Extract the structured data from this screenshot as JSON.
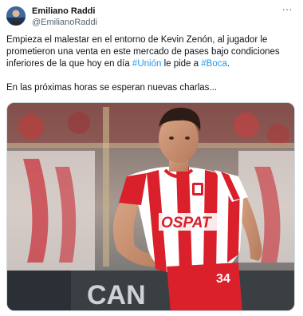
{
  "author": {
    "display_name": "Emiliano Raddi",
    "handle": "@EmilianoRaddi"
  },
  "tweet": {
    "paragraph_1_before": "Empieza el malestar en el entorno de Kevin Zenón, al jugador le prometieron una venta en este mercado de pases bajo condiciones inferiores de la que hoy en día ",
    "hashtag_union": "#Unión",
    "paragraph_1_middle": " le pide a ",
    "hashtag_boca": "#Boca",
    "paragraph_1_end": ".",
    "paragraph_2": "En las próximas horas se esperan nuevas charlas..."
  },
  "media": {
    "jersey_sponsor": "OSPAT",
    "jersey_number": "34",
    "banner_text": "CAN"
  },
  "colors": {
    "link": "#1d9bf0",
    "text": "#0f1419",
    "secondary": "#536471",
    "jersey_red": "#d9202b"
  },
  "icons": {
    "more": "more-horizontal-icon"
  },
  "more_glyph": "···"
}
